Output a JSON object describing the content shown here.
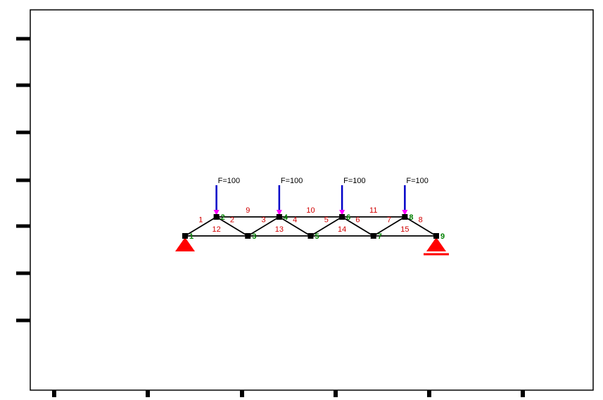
{
  "chart_data": {
    "type": "diagram",
    "title": "",
    "xlabel": "",
    "ylabel": "",
    "nodes": [
      {
        "id": 1,
        "x": 0,
        "y": 0
      },
      {
        "id": 2,
        "x": 0.5,
        "y": 0.3
      },
      {
        "id": 3,
        "x": 1,
        "y": 0
      },
      {
        "id": 4,
        "x": 1.5,
        "y": 0.3
      },
      {
        "id": 5,
        "x": 2,
        "y": 0
      },
      {
        "id": 6,
        "x": 2.5,
        "y": 0.3
      },
      {
        "id": 7,
        "x": 3,
        "y": 0
      },
      {
        "id": 8,
        "x": 3.5,
        "y": 0.3
      },
      {
        "id": 9,
        "x": 4,
        "y": 0
      }
    ],
    "members": [
      {
        "id": 1,
        "n1": 1,
        "n2": 2
      },
      {
        "id": 2,
        "n1": 2,
        "n2": 3
      },
      {
        "id": 3,
        "n1": 3,
        "n2": 4
      },
      {
        "id": 4,
        "n1": 4,
        "n2": 5
      },
      {
        "id": 5,
        "n1": 5,
        "n2": 6
      },
      {
        "id": 6,
        "n1": 6,
        "n2": 7
      },
      {
        "id": 7,
        "n1": 7,
        "n2": 8
      },
      {
        "id": 8,
        "n1": 8,
        "n2": 9
      },
      {
        "id": 9,
        "n1": 2,
        "n2": 4
      },
      {
        "id": 10,
        "n1": 4,
        "n2": 6
      },
      {
        "id": 11,
        "n1": 6,
        "n2": 8
      },
      {
        "id": 12,
        "n1": 1,
        "n2": 3
      },
      {
        "id": 13,
        "n1": 3,
        "n2": 5
      },
      {
        "id": 14,
        "n1": 5,
        "n2": 7
      },
      {
        "id": 15,
        "n1": 7,
        "n2": 9
      }
    ],
    "forces": [
      {
        "node": 2,
        "label": "F=100",
        "magnitude": 100,
        "dir": "-y"
      },
      {
        "node": 4,
        "label": "F=100",
        "magnitude": 100,
        "dir": "-y"
      },
      {
        "node": 6,
        "label": "F=100",
        "magnitude": 100,
        "dir": "-y"
      },
      {
        "node": 8,
        "label": "F=100",
        "magnitude": 100,
        "dir": "-y"
      }
    ],
    "supports": [
      {
        "node": 1,
        "type": "pin"
      },
      {
        "node": 9,
        "type": "roller"
      }
    ],
    "node_label_color": "#008000",
    "member_label_color": "#d00000",
    "force_color": "#0000c8",
    "support_color": "#ff0000"
  },
  "members_text_prefix": "",
  "force_label": "F=100"
}
